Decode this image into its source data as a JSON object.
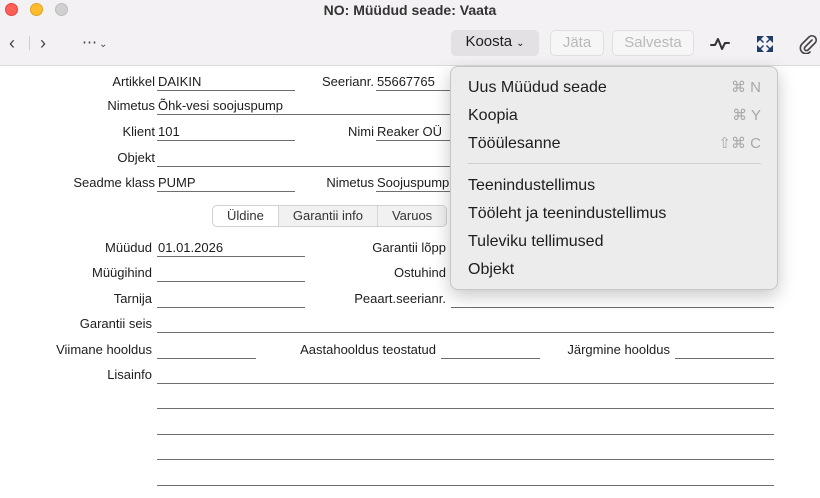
{
  "window": {
    "title": "NO: Müüdud seade: Vaata"
  },
  "toolbar": {
    "back_glyph": "‹",
    "forward_glyph": "›",
    "more_glyph": "⋯",
    "more_chev": "⌄",
    "koosta_label": "Koosta",
    "koosta_chev": "⌄",
    "jata_label": "Jäta",
    "salvesta_label": "Salvesta",
    "icons": [
      "activity-icon",
      "expand-icon",
      "paperclip-icon"
    ]
  },
  "form": {
    "artikkel": {
      "label": "Artikkel",
      "value": "DAIKIN"
    },
    "seerianr": {
      "label": "Seerianr.",
      "value": "55667765"
    },
    "nimetus": {
      "label": "Nimetus",
      "value": "Õhk-vesi soojuspump"
    },
    "klient": {
      "label": "Klient",
      "value": "101"
    },
    "nimi": {
      "label": "Nimi",
      "value": "Reaker OÜ"
    },
    "objekt": {
      "label": "Objekt",
      "value": ""
    },
    "seadme_klass": {
      "label": "Seadme klass",
      "value": "PUMP"
    },
    "nimetus2": {
      "label": "Nimetus",
      "value": "Soojuspump"
    }
  },
  "tabs": [
    "Üldine",
    "Garantii info",
    "Varuos"
  ],
  "general": {
    "muudud": {
      "label": "Müüdud",
      "value": "01.01.2026"
    },
    "garantii_lopp": {
      "label": "Garantii lõpp",
      "value": ""
    },
    "muugihind": {
      "label": "Müügihind",
      "value": ""
    },
    "ostuhind": {
      "label": "Ostuhind",
      "value": ""
    },
    "tarnija": {
      "label": "Tarnija",
      "value": ""
    },
    "peaart": {
      "label": "Peaart.seerianr.",
      "value": ""
    },
    "garantii_seis": {
      "label": "Garantii seis",
      "value": ""
    },
    "viimane_hooldus": {
      "label": "Viimane hooldus",
      "value": ""
    },
    "aastahooldus": {
      "label": "Aastahooldus teostatud",
      "value": ""
    },
    "jargmine_hooldus": {
      "label": "Järgmine hooldus",
      "value": ""
    },
    "lisainfo": {
      "label": "Lisainfo",
      "value": ""
    }
  },
  "menu": {
    "items": [
      {
        "label": "Uus Müüdud seade",
        "shortcut": "⌘ N"
      },
      {
        "label": "Koopia",
        "shortcut": "⌘ Y"
      },
      {
        "label": "Tööülesanne",
        "shortcut": "⇧⌘ C"
      },
      {
        "label": "Teenindustellimus",
        "shortcut": ""
      },
      {
        "label": "Tööleht ja teenindustellimus",
        "shortcut": ""
      },
      {
        "label": "Tuleviku tellimused",
        "shortcut": ""
      },
      {
        "label": "Objekt",
        "shortcut": ""
      }
    ]
  },
  "colors": {
    "close": "#ff5f57",
    "minimize": "#febc2e",
    "maximize": "#d0d0d0",
    "expand_icon": "#1f3d66"
  }
}
